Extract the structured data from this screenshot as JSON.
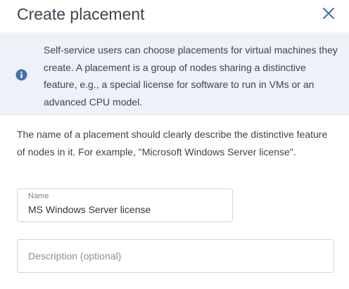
{
  "dialog": {
    "title": "Create placement",
    "close_icon": "close-icon"
  },
  "info_banner": {
    "icon": "info-icon",
    "text": "Self-service users can choose placements for virtual machines they create. A placement is a group of nodes sharing a distinctive feature, e.g., a special license for software to run in VMs or an advanced CPU model."
  },
  "description": "The name of a placement should clearly describe the distinctive feature of nodes in it. For example, \"Microsoft Windows Server license\".",
  "form": {
    "name": {
      "label": "Name",
      "value": "MS Windows Server license"
    },
    "description": {
      "placeholder": "Description (optional)",
      "value": ""
    }
  },
  "colors": {
    "accent": "#4a6ea9",
    "banner_bg": "#eef1f7",
    "border": "#cfd4dc"
  }
}
